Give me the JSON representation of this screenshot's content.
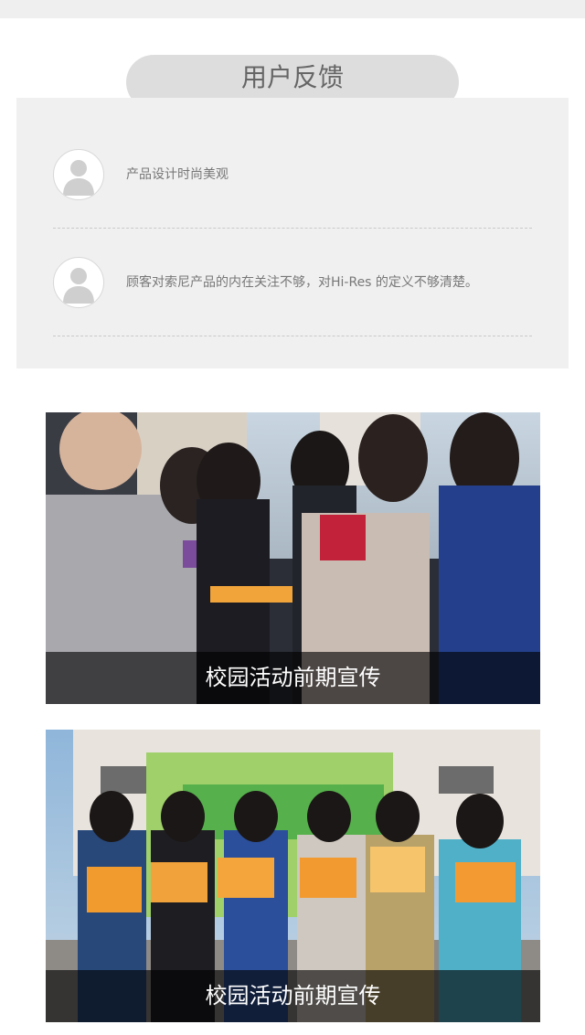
{
  "feedback": {
    "title": "用户反馈",
    "items": [
      {
        "avatar_icon": "user-avatar-icon",
        "text": "产品设计时尚美观"
      },
      {
        "avatar_icon": "user-avatar-icon",
        "text": "顾客对索尼产品的内在关注不够，对Hi-Res 的定义不够清楚。"
      }
    ]
  },
  "gallery": [
    {
      "caption": "校园活动前期宣传"
    },
    {
      "caption": "校园活动前期宣传"
    }
  ],
  "colors": {
    "header_pill": "#dddddd",
    "panel_bg": "#f0f0f0",
    "caption_bg": "rgba(0,0,0,0.62)",
    "text_gray": "#777777"
  }
}
